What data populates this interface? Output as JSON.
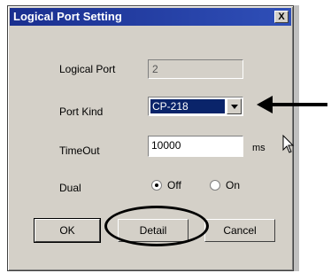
{
  "window": {
    "title": "Logical Port Setting",
    "close_label": "X"
  },
  "logical_port": {
    "label": "Logical Port",
    "value": "2"
  },
  "port_kind": {
    "label": "Port Kind",
    "selected": "CP-218"
  },
  "timeout": {
    "label": "TimeOut",
    "value": "10000",
    "unit": "ms"
  },
  "dual": {
    "label": "Dual",
    "off_label": "Off",
    "on_label": "On",
    "selected": "Off"
  },
  "buttons": {
    "ok": "OK",
    "detail": "Detail",
    "cancel": "Cancel"
  }
}
